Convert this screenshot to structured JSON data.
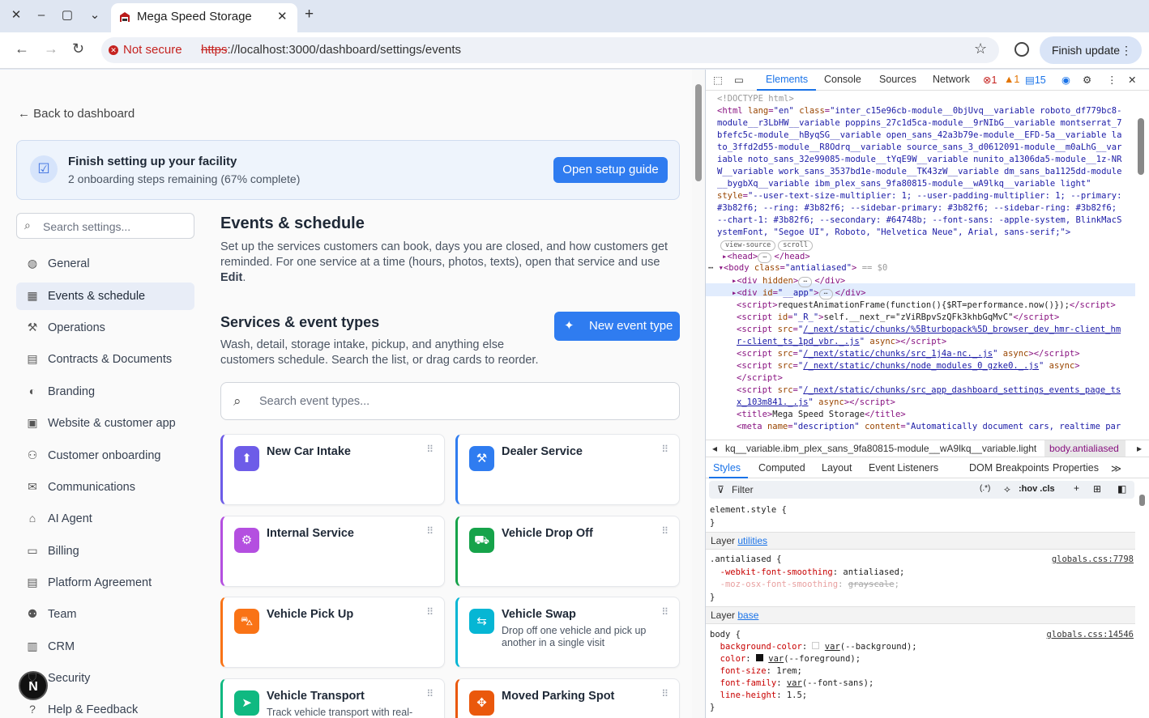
{
  "browser": {
    "tab_title": "Mega Speed Storage",
    "not_secure": "Not secure",
    "url_scheme": "https",
    "url_rest": "://localhost:3000/dashboard/settings/events",
    "finish_update": "Finish update"
  },
  "page": {
    "back_label": "Back to dashboard",
    "banner": {
      "title": "Finish setting up your facility",
      "subtitle": "2 onboarding steps remaining (67% complete)",
      "button": "Open setup guide"
    },
    "search_placeholder": "Search settings...",
    "sidebar": [
      {
        "label": "General",
        "icon": "globe-icon"
      },
      {
        "label": "Events & schedule",
        "icon": "calendar-icon",
        "active": true
      },
      {
        "label": "Operations",
        "icon": "wrench-icon"
      },
      {
        "label": "Contracts & Documents",
        "icon": "document-icon"
      },
      {
        "label": "Branding",
        "icon": "palette-icon"
      },
      {
        "label": "Website & customer app",
        "icon": "devices-icon"
      },
      {
        "label": "Customer onboarding",
        "icon": "user-plus-icon"
      },
      {
        "label": "Communications",
        "icon": "mail-icon"
      },
      {
        "label": "AI Agent",
        "icon": "bot-icon"
      },
      {
        "label": "Billing",
        "icon": "credit-card-icon"
      },
      {
        "label": "Platform Agreement",
        "icon": "document-icon"
      },
      {
        "label": "Team",
        "icon": "users-icon"
      },
      {
        "label": "CRM",
        "icon": "contact-card-icon"
      },
      {
        "label": "Security",
        "icon": "shield-icon"
      },
      {
        "label": "Help & Feedback",
        "icon": "help-icon"
      }
    ],
    "events_title": "Events & schedule",
    "events_desc": "Set up the services customers can book, days you are closed, and how customers get reminded. For one service at a time (hours, photos, texts), open that service and use",
    "events_desc_bold": "Edit",
    "services_title": "Services & event types",
    "services_desc": "Wash, detail, storage intake, pickup, and anything else customers schedule. Search the list, or drag cards to reorder.",
    "new_event_label": "New event type",
    "event_search_placeholder": "Search event types...",
    "cards": [
      {
        "title": "New Car Intake",
        "desc": "",
        "color": "#6d5ce8",
        "icon": "arrow-up-circle-icon"
      },
      {
        "title": "Dealer Service",
        "desc": "",
        "color": "#2f7cf0",
        "icon": "wrench-icon"
      },
      {
        "title": "Internal Service",
        "desc": "",
        "color": "#b44fe0",
        "icon": "gear-icon"
      },
      {
        "title": "Vehicle Drop Off",
        "desc": "",
        "color": "#16a34a",
        "icon": "truck-icon"
      },
      {
        "title": "Vehicle Pick Up",
        "desc": "",
        "color": "#f97316",
        "icon": "car-icon"
      },
      {
        "title": "Vehicle Swap",
        "desc": "Drop off one vehicle and pick up another in a single visit",
        "color": "#06b6d4",
        "icon": "swap-icon"
      },
      {
        "title": "Vehicle Transport",
        "desc": "Track vehicle transport with real-",
        "color": "#10b981",
        "icon": "send-icon"
      },
      {
        "title": "Moved Parking Spot",
        "desc": "",
        "color": "#ea580c",
        "icon": "move-icon"
      }
    ]
  },
  "devtools": {
    "tabs": [
      "Elements",
      "Console",
      "Sources",
      "Network"
    ],
    "errors": "1",
    "warnings": "1",
    "messages": "15",
    "crumb_left": "kq__variable.ibm_plex_sans_9fa80815-module__wA9lkq__variable.light",
    "crumb_right": "body.antialiased",
    "style_tabs": [
      "Styles",
      "Computed",
      "Layout",
      "Event Listeners",
      "DOM Breakpoints",
      "Properties"
    ],
    "filter_label": "Filter",
    "filter_tools": ":hov .cls",
    "layer1": "utilities",
    "layer2": "base",
    "src1": "globals.css:7798",
    "src2": "globals.css:14546"
  }
}
